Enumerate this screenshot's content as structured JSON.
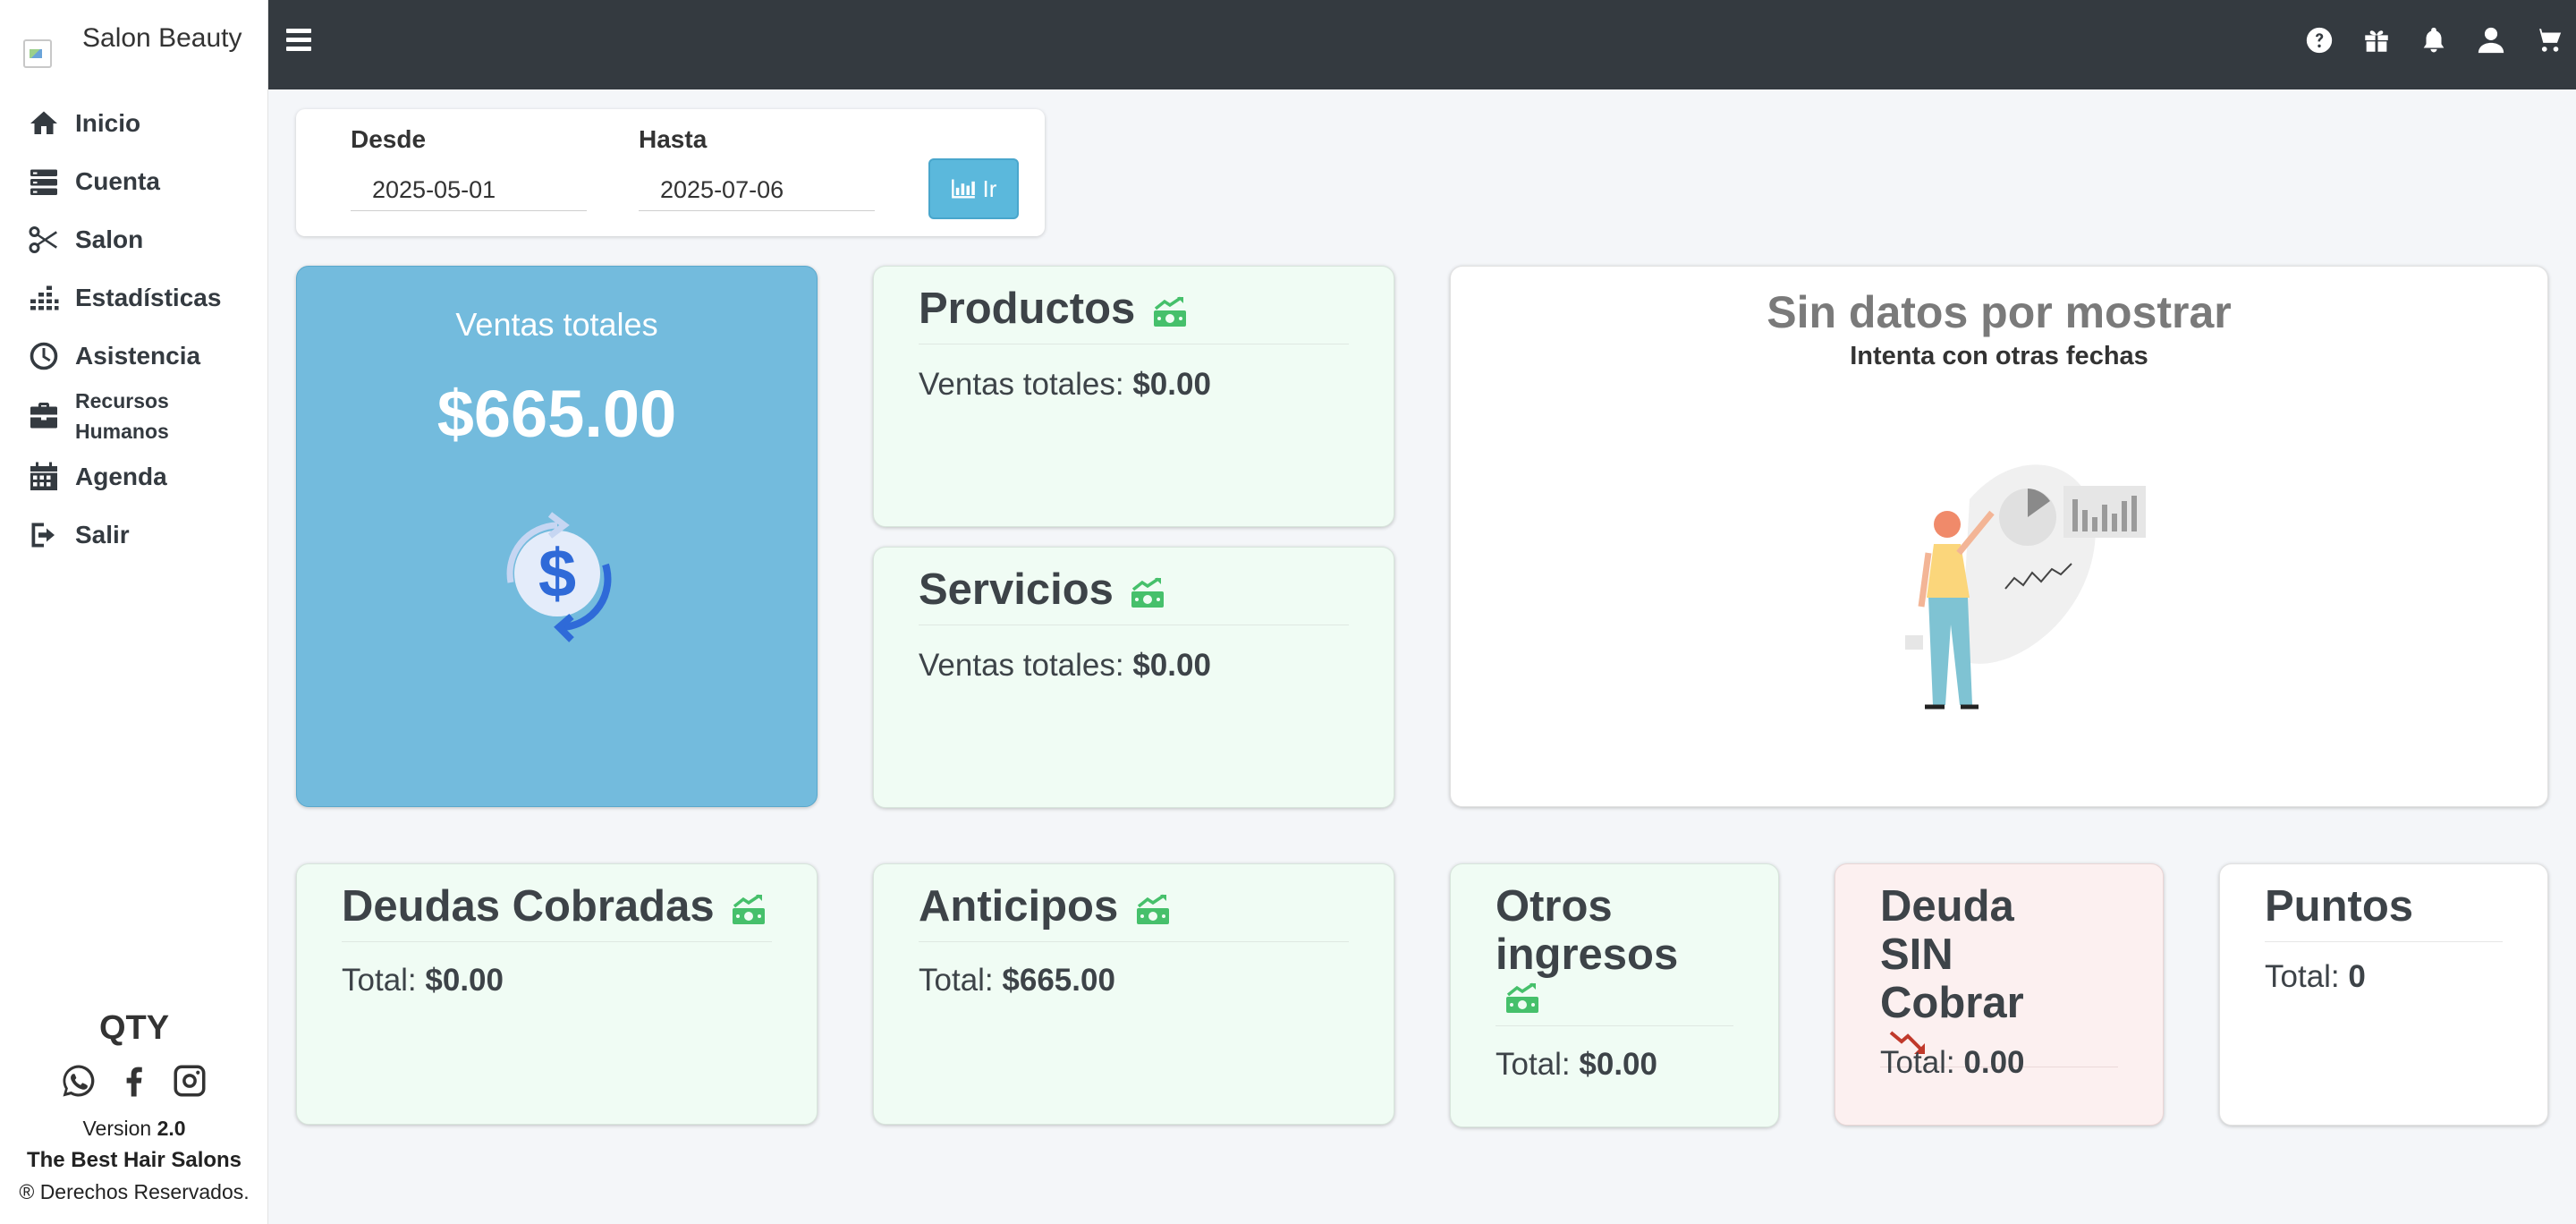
{
  "brand": {
    "name": "Salon Beauty"
  },
  "nav": [
    {
      "label": "Inicio",
      "icon": "home-icon"
    },
    {
      "label": "Cuenta",
      "icon": "account-icon"
    },
    {
      "label": "Salon",
      "icon": "scissors-icon"
    },
    {
      "label": "Estadísticas",
      "icon": "stats-icon"
    },
    {
      "label": "Asistencia",
      "icon": "clock-icon"
    },
    {
      "label": "Recursos Humanos",
      "icon": "briefcase-icon"
    },
    {
      "label": "Agenda",
      "icon": "calendar-icon"
    },
    {
      "label": "Salir",
      "icon": "logout-icon"
    }
  ],
  "footer": {
    "brand": "QTY",
    "version_label": "Version",
    "version": "2.0",
    "tagline": "The Best Hair Salons",
    "rights": "® Derechos Reservados."
  },
  "topbar": {
    "icons": [
      "help-icon",
      "gift-icon",
      "bell-icon",
      "user-icon",
      "cart-icon"
    ]
  },
  "filter": {
    "from_label": "Desde",
    "from_value": "2025-05-01",
    "to_label": "Hasta",
    "to_value": "2025-07-06",
    "go_label": "Ir"
  },
  "total_sales": {
    "title": "Ventas totales",
    "value": "$665.00"
  },
  "products": {
    "title": "Productos",
    "line_label": "Ventas totales:",
    "value": "$0.00"
  },
  "services": {
    "title": "Servicios",
    "line_label": "Ventas totales:",
    "value": "$0.00"
  },
  "nodata": {
    "title": "Sin datos por mostrar",
    "subtitle": "Intenta con otras fechas"
  },
  "debts_collected": {
    "title": "Deudas Cobradas",
    "line_label": "Total:",
    "value": "$0.00"
  },
  "advances": {
    "title": "Anticipos",
    "line_label": "Total:",
    "value": "$665.00"
  },
  "other_income": {
    "title": "Otros ingresos",
    "line_label": "Total:",
    "value": "$0.00"
  },
  "unpaid_debt": {
    "title": "Deuda SIN Cobrar",
    "line_label": "Total:",
    "value": "0.00"
  },
  "points": {
    "title": "Puntos",
    "line_label": "Total:",
    "value": "0"
  },
  "colors": {
    "topbar": "#343a40",
    "accent_blue": "#73bbdd",
    "card_green": "#f0fcf4",
    "card_pink": "#fcf0f0",
    "money_green": "#46c06b",
    "down_red": "#c0392b"
  }
}
